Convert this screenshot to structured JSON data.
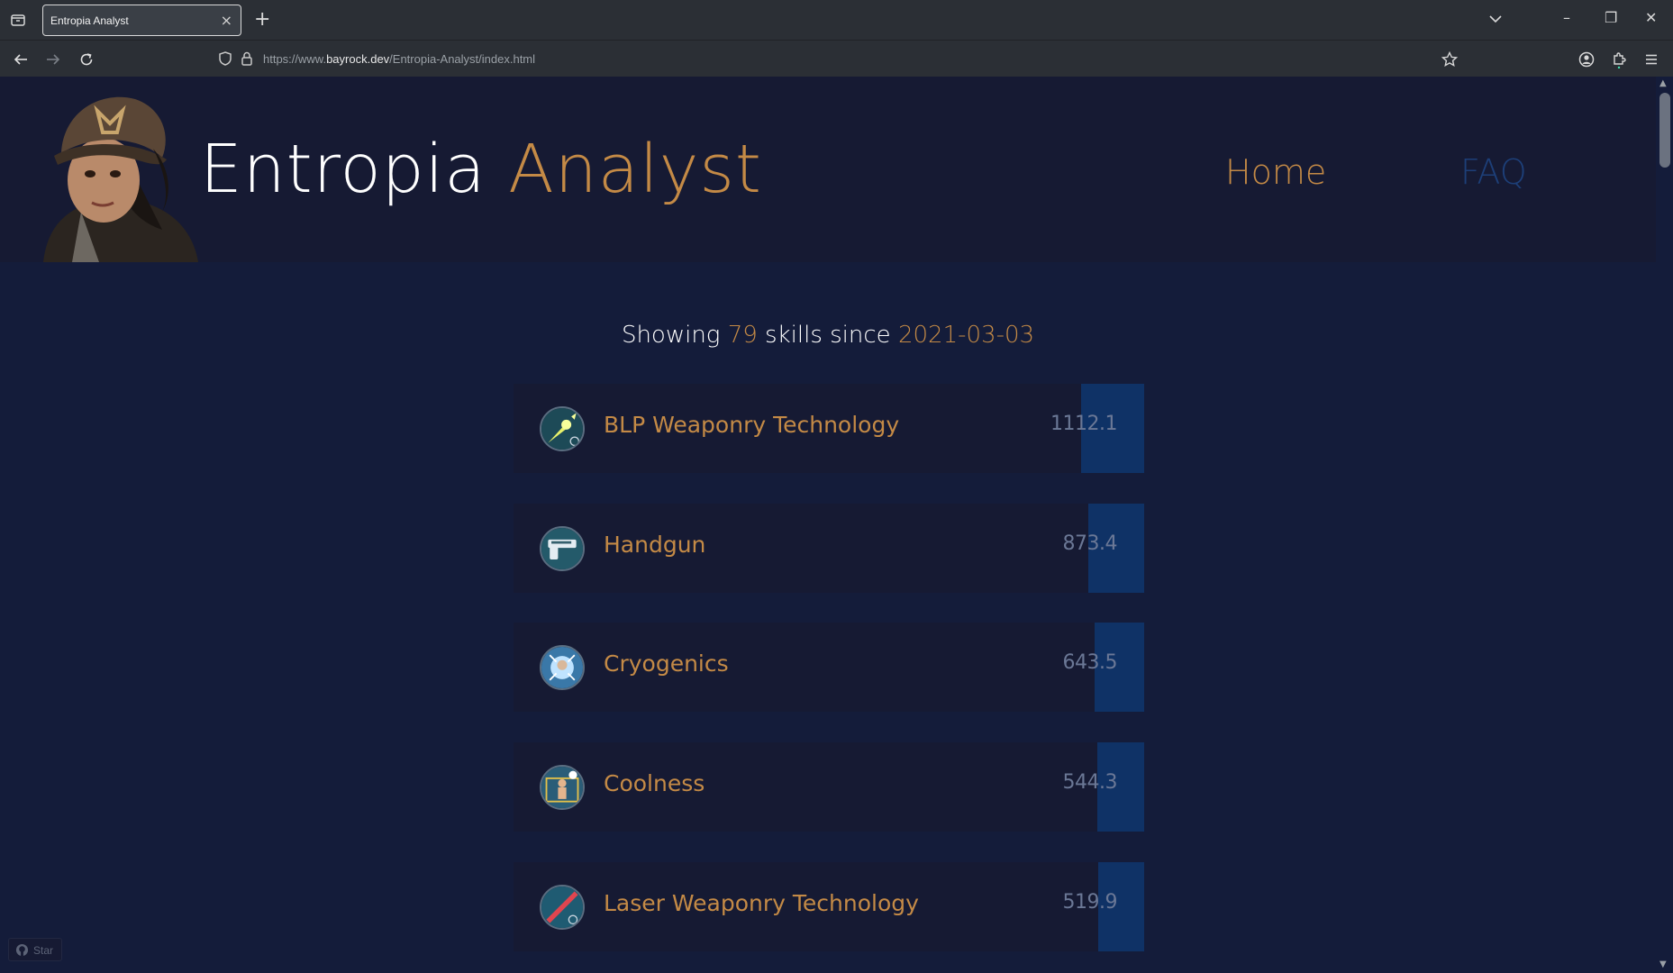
{
  "browser": {
    "tab_title": "Entropia Analyst",
    "tab_close": "×",
    "new_tab": "+",
    "url_prefix": "https://www.",
    "url_host": "bayrock.dev",
    "url_path": "/Entropia-Analyst/index.html",
    "window_controls": [
      "–",
      "❐",
      "✕"
    ]
  },
  "site": {
    "title_main": "Entropia",
    "title_accent": "Analyst",
    "nav": {
      "home": "Home",
      "faq": "FAQ"
    },
    "accent_color": "#c48a46",
    "background_color": "#141c3a"
  },
  "summary": {
    "prefix": "Showing",
    "count": "79",
    "middle": "skills since",
    "date": "2021-03-03"
  },
  "skills": [
    {
      "name": "BLP Weaponry Technology",
      "value": "1112.1",
      "icon": "blp-weapon-icon",
      "fraction": 1.0
    },
    {
      "name": "Handgun",
      "value": "873.4",
      "icon": "handgun-icon",
      "fraction": 0.785
    },
    {
      "name": "Cryogenics",
      "value": "643.5",
      "icon": "cryogenics-icon",
      "fraction": 0.579
    },
    {
      "name": "Coolness",
      "value": "544.3",
      "icon": "coolness-icon",
      "fraction": 0.489
    },
    {
      "name": "Laser Weaponry Technology",
      "value": "519.9",
      "icon": "laser-weapon-icon",
      "fraction": 0.467
    }
  ],
  "github": {
    "star_label": "Star"
  }
}
